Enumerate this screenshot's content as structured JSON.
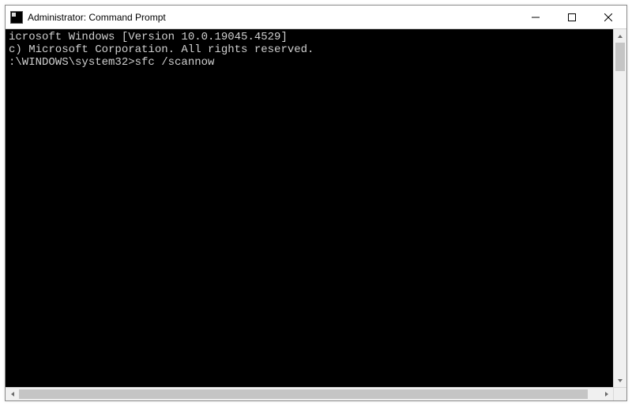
{
  "window": {
    "title": "Administrator: Command Prompt"
  },
  "terminal": {
    "lines": [
      "icrosoft Windows [Version 10.0.19045.4529]",
      "c) Microsoft Corporation. All rights reserved.",
      "",
      ":\\WINDOWS\\system32>sfc /scannow"
    ],
    "prompt": ":\\WINDOWS\\system32>",
    "command": "sfc /scannow"
  }
}
